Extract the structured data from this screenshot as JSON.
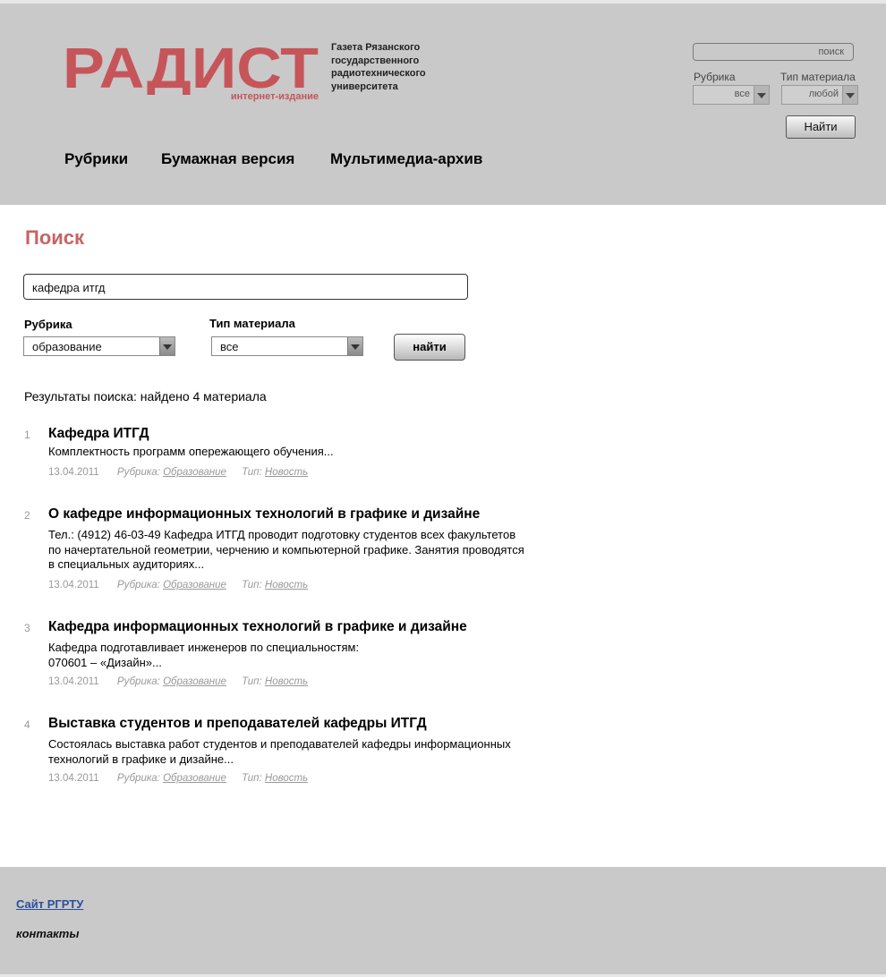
{
  "header": {
    "logo_text": "РАДИСТ",
    "logo_subtitle": "интернет-издание",
    "tagline_lines": [
      "Газета Рязанского",
      "государственного",
      "радиотехнического",
      "университета"
    ],
    "search_placeholder": "поиск",
    "rubric_label": "Рубрика",
    "rubric_value": "все",
    "type_label": "Тип материала",
    "type_value": "любой",
    "find_button": "Найти",
    "nav": [
      "Рубрики",
      "Бумажная версия",
      "Мультимедиа-архив"
    ]
  },
  "colors": {
    "brand": "#c6555a",
    "title": "#c86464",
    "header_bg": "#c9c9c9",
    "footer_link": "#2b4f9c"
  },
  "main": {
    "title": "Поиск",
    "query": "кафедра итгд",
    "rubric_label": "Рубрика",
    "rubric_value": "образование",
    "type_label": "Тип материала",
    "type_value": "все",
    "find_button": "найти",
    "results_summary": "Результаты поиска: найдено 4 материала",
    "results": [
      {
        "num": "1",
        "title": "Кафедра ИТГД",
        "snippet_lines": [
          "Комплектность программ опережающего обучения..."
        ],
        "date": "13.04.2011",
        "rubric_label": "Рубрика:",
        "rubric": "Образование",
        "type_label": "Тип:",
        "type": "Новость"
      },
      {
        "num": "2",
        "title": "О кафедре информационных технологий в графике и дизайне",
        "snippet_lines": [
          "Тел.: (4912) 46-03-49 Кафедра ИТГД проводит подготовку студентов всех факультетов",
          "по начертательной геометрии, черчению и компьютерной графике. Занятия проводятся",
          "в специальных аудиториях..."
        ],
        "date": "13.04.2011",
        "rubric_label": "Рубрика:",
        "rubric": "Образование",
        "type_label": "Тип:",
        "type": "Новость"
      },
      {
        "num": "3",
        "title": "Кафедра информационных технологий в графике и дизайне",
        "snippet_lines": [
          "Кафедра подготавливает инженеров по специальностям:",
          "070601 – «Дизайн»..."
        ],
        "date": "13.04.2011",
        "rubric_label": "Рубрика:",
        "rubric": "Образование",
        "type_label": "Тип:",
        "type": "Новость"
      },
      {
        "num": "4",
        "title": "Выставка студентов и преподавателей кафедры ИТГД",
        "snippet_lines": [
          "Состоялась выставка работ студентов и преподавателей кафедры информационных",
          "технологий в графике и дизайне..."
        ],
        "date": "13.04.2011",
        "rubric_label": "Рубрика:",
        "rubric": "Образование",
        "type_label": "Тип:",
        "type": "Новость"
      }
    ]
  },
  "footer": {
    "site_link": "Сайт РГРТУ",
    "contacts": "контакты"
  }
}
